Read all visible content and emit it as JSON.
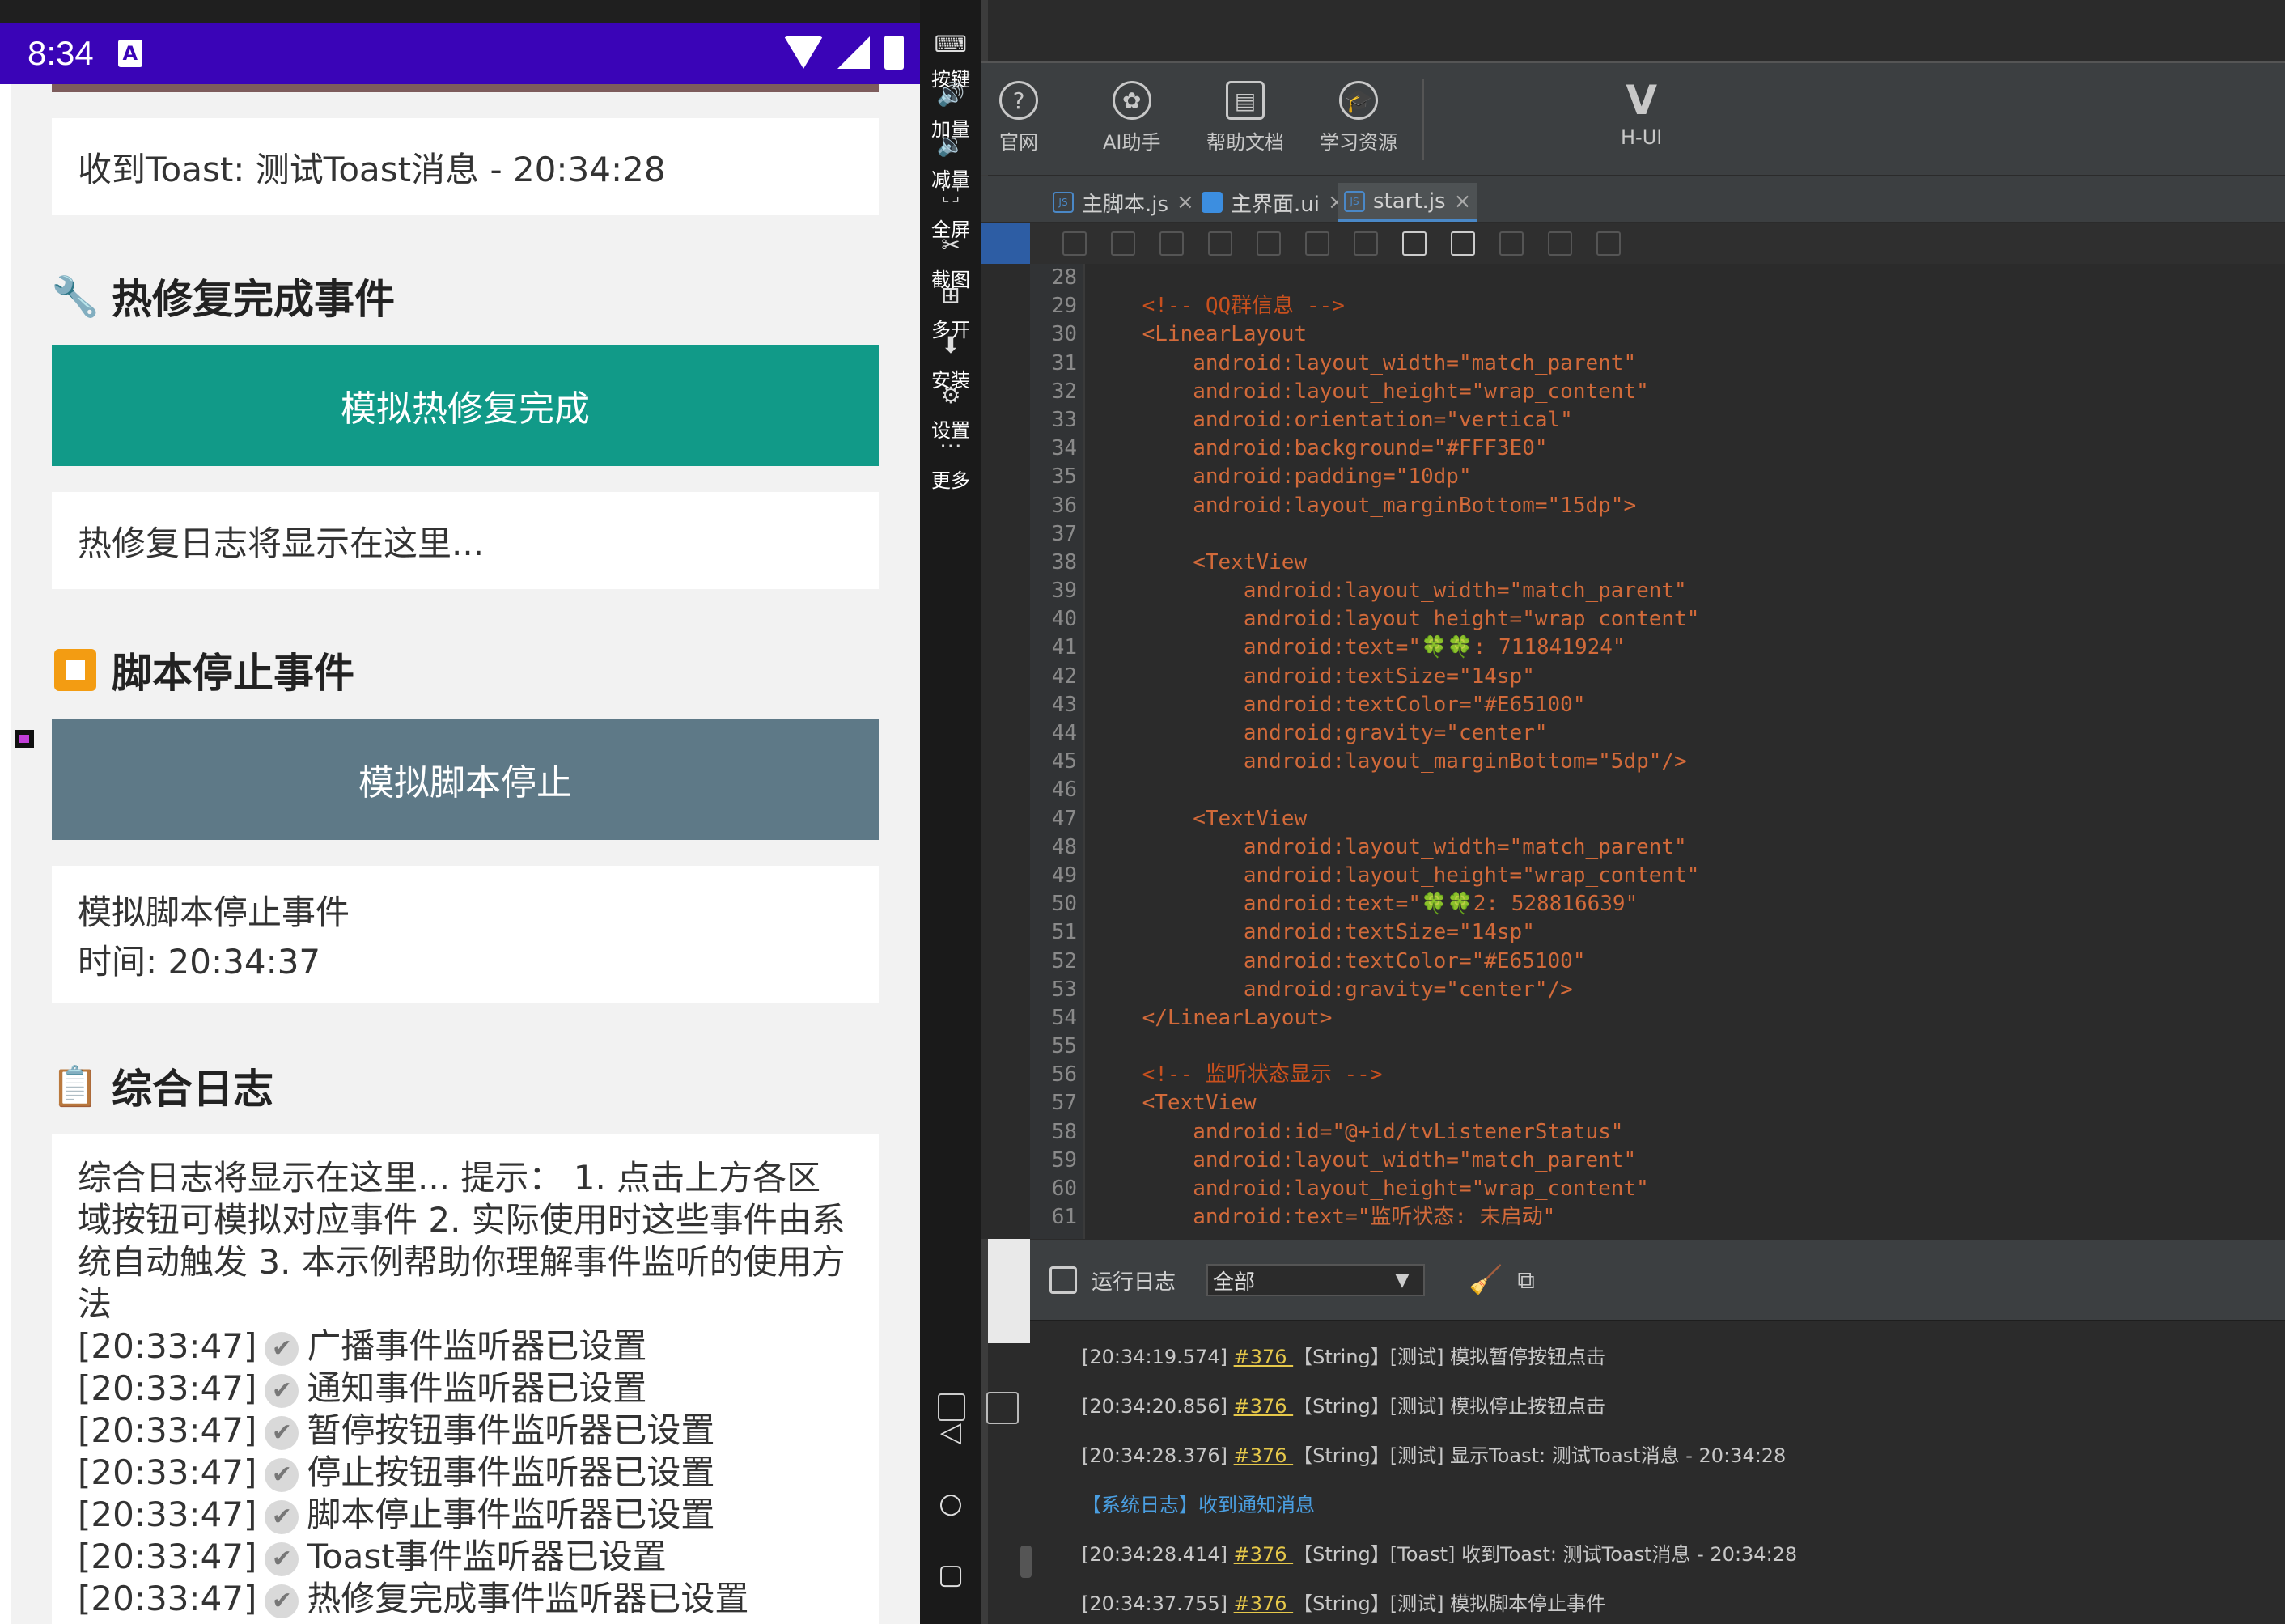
{
  "phone": {
    "time": "8:34",
    "notif_icon": "A",
    "toast_received": "收到Toast: 测试Toast消息 - 20:34:28",
    "hotfix_section": {
      "icon": "wrench-icon",
      "title": "热修复完成事件"
    },
    "hotfix_button": "模拟热修复完成",
    "hotfix_log": "热修复日志将显示在这里...",
    "stop_section": {
      "icon": "stop-square-icon",
      "title": "脚本停止事件"
    },
    "stop_button": "模拟脚本停止",
    "stop_log_line1": "模拟脚本停止事件",
    "stop_log_line2": "时间: 20:34:37",
    "log_section": {
      "icon": "clipboard-icon",
      "title": "综合日志"
    },
    "log_intro": "综合日志将显示在这里... 提示： 1. 点击上方各区域按钮可模拟对应事件 2. 实际使用时这些事件由系统自动触发 3. 本示例帮助你理解事件监听的使用方法",
    "log_entries": [
      {
        "time": "[20:33:47]",
        "text": "广播事件监听器已设置"
      },
      {
        "time": "[20:33:47]",
        "text": "通知事件监听器已设置"
      },
      {
        "time": "[20:33:47]",
        "text": "暂停按钮事件监听器已设置"
      },
      {
        "time": "[20:33:47]",
        "text": "停止按钮事件监听器已设置"
      },
      {
        "time": "[20:33:47]",
        "text": "脚本停止事件监听器已设置"
      },
      {
        "time": "[20:33:47]",
        "text": "Toast事件监听器已设置"
      },
      {
        "time": "[20:33:47]",
        "text": "热修复完成事件监听器已设置"
      }
    ],
    "colors": {
      "status_bar": "#3a04b7",
      "hotfix_button": "#119a88",
      "stop_button": "#5e7987"
    }
  },
  "emulator_sidebar": [
    {
      "icon": "keyboard-icon",
      "label": "按键"
    },
    {
      "icon": "volume-up-icon",
      "label": "加量"
    },
    {
      "icon": "volume-down-icon",
      "label": "减量"
    },
    {
      "icon": "fullscreen-icon",
      "label": "全屏"
    },
    {
      "icon": "scissors-icon",
      "label": "截图"
    },
    {
      "icon": "multi-open-icon",
      "label": "多开"
    },
    {
      "icon": "apk-install-icon",
      "label": "安装"
    },
    {
      "icon": "settings-icon",
      "label": "设置"
    },
    {
      "icon": "more-icon",
      "label": "更多"
    }
  ],
  "ide": {
    "toolbar": [
      {
        "icon": "help-icon",
        "label": "官网"
      },
      {
        "icon": "openai-icon",
        "label": "AI助手"
      },
      {
        "icon": "document-icon",
        "label": "帮助文档"
      },
      {
        "icon": "graduation-cap-icon",
        "label": "学习资源"
      },
      {
        "icon": "v-logo-icon",
        "label": "H-UI"
      }
    ],
    "tabs": [
      {
        "label": "主脚本.js",
        "close": "×"
      },
      {
        "label": "主界面.ui",
        "close": "×"
      },
      {
        "label": "start.js",
        "close": "×"
      }
    ],
    "line_start": 28,
    "code_lines": [
      "",
      "    <!-- QQ群信息 -->",
      "    <LinearLayout",
      "        android:layout_width=\"match_parent\"",
      "        android:layout_height=\"wrap_content\"",
      "        android:orientation=\"vertical\"",
      "        android:background=\"#FFF3E0\"",
      "        android:padding=\"10dp\"",
      "        android:layout_marginBottom=\"15dp\">",
      "",
      "        <TextView",
      "            android:layout_width=\"match_parent\"",
      "            android:layout_height=\"wrap_content\"",
      "            android:text=\"🍀🍀: 711841924\"",
      "            android:textSize=\"14sp\"",
      "            android:textColor=\"#E65100\"",
      "            android:gravity=\"center\"",
      "            android:layout_marginBottom=\"5dp\"/>",
      "",
      "        <TextView",
      "            android:layout_width=\"match_parent\"",
      "            android:layout_height=\"wrap_content\"",
      "            android:text=\"🍀🍀2: 528816639\"",
      "            android:textSize=\"14sp\"",
      "            android:textColor=\"#E65100\"",
      "            android:gravity=\"center\"/>",
      "    </LinearLayout>",
      "",
      "    <!-- 监听状态显示 -->",
      "    <TextView",
      "        android:id=\"@+id/tvListenerStatus\"",
      "        android:layout_width=\"match_parent\"",
      "        android:layout_height=\"wrap_content\"",
      "        android:text=\"监听状态: 未启动\""
    ],
    "log_panel": {
      "title": "运行日志",
      "filter": "全部",
      "lines": [
        {
          "prefix": "[20:34:19.574] ",
          "link": "#376 ",
          "rest": "【String】[测试] 模拟暂停按钮点击"
        },
        {
          "prefix": "[20:34:20.856] ",
          "link": "#376 ",
          "rest": "【String】[测试] 模拟停止按钮点击"
        },
        {
          "prefix": "[20:34:28.376] ",
          "link": "#376 ",
          "rest": "【String】[测试] 显示Toast: 测试Toast消息 - 20:34:28"
        },
        {
          "prefix": "【系统日志】收到通知消息",
          "link": "",
          "rest": ""
        },
        {
          "prefix": "[20:34:28.414] ",
          "link": "#376 ",
          "rest": "【String】[Toast] 收到Toast: 测试Toast消息 - 20:34:28"
        },
        {
          "prefix": "[20:34:37.755] ",
          "link": "#376 ",
          "rest": "【String】[测试] 模拟脚本停止事件"
        }
      ]
    }
  }
}
